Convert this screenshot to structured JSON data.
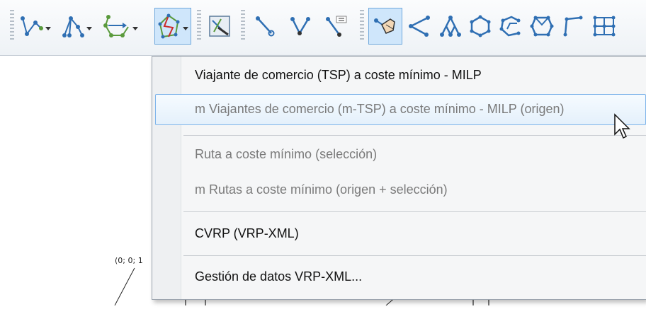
{
  "toolbar": {
    "buttons": [
      {
        "icon": "open-path-tool-icon",
        "has_dropdown": true
      },
      {
        "icon": "tree-tool-icon",
        "has_dropdown": true
      },
      {
        "icon": "flow-tool-icon",
        "has_dropdown": true
      },
      {
        "icon": "routing-tool-icon",
        "has_dropdown": true,
        "active": true
      },
      {
        "icon": "edit-graph-icon"
      },
      {
        "icon": "add-edge-icon"
      },
      {
        "icon": "add-arc-icon"
      },
      {
        "icon": "numbered-edge-icon"
      },
      {
        "icon": "hand-node-tool-icon",
        "active": true
      },
      {
        "icon": "open-polyline-icon"
      },
      {
        "icon": "tree-shape-icon"
      },
      {
        "icon": "hexagon-cycle-icon"
      },
      {
        "icon": "open-cycle-icon"
      },
      {
        "icon": "closed-cycle-icon"
      },
      {
        "icon": "corner-path-icon"
      },
      {
        "icon": "grid-graph-icon"
      }
    ]
  },
  "menu": {
    "items": [
      {
        "label": "Viajante de comercio (TSP) a coste mínimo - MILP",
        "enabled": true
      },
      {
        "label": "m Viajantes de comercio (m-TSP) a coste mínimo - MILP (origen)",
        "enabled": false,
        "highlighted": true
      },
      {
        "label": "Ruta a coste mínimo (selección)",
        "enabled": false
      },
      {
        "label": "m Rutas a coste mínimo (origen + selección)",
        "enabled": false
      },
      {
        "label": "CVRP (VRP-XML)",
        "enabled": true
      },
      {
        "label": "Gestión de datos VRP-XML...",
        "enabled": true
      }
    ]
  },
  "canvas": {
    "node_label": "(0; 0; 1"
  },
  "colors": {
    "icon_blue": "#2f6fb3",
    "icon_green": "#5a9a3c",
    "icon_red": "#cc2a2a",
    "highlight_border": "#7eb4ea"
  }
}
